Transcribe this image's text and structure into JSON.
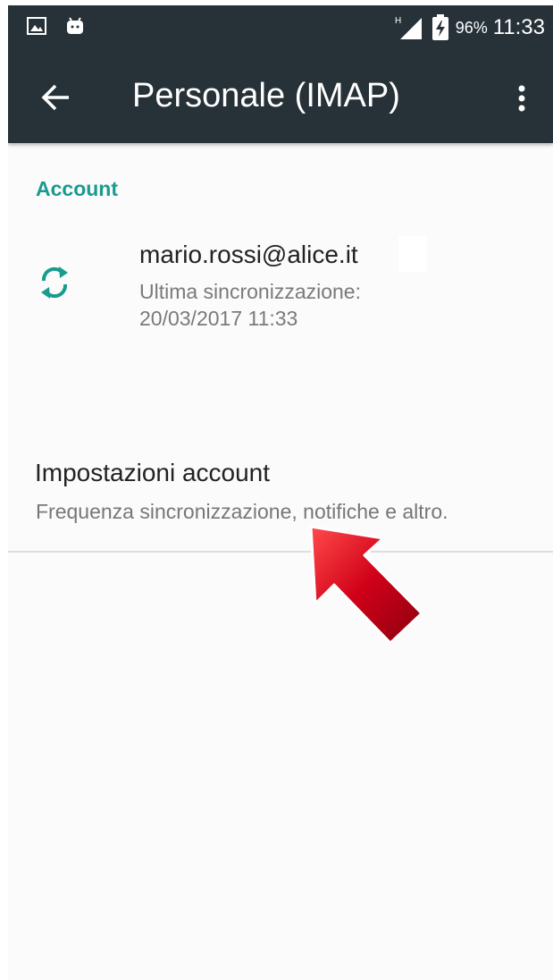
{
  "status_bar": {
    "battery_percent": "96%",
    "time": "11:33",
    "network_type": "H",
    "icons": [
      "image-icon",
      "android-icon",
      "signal-icon",
      "battery-charging-icon"
    ]
  },
  "toolbar": {
    "title": "Personale (IMAP)",
    "back_icon": "arrow-back-icon",
    "more_icon": "more-vert-icon"
  },
  "section": {
    "header": "Account"
  },
  "account": {
    "email": "mario.rossi@alice.it",
    "sync_label": "Ultima sincronizzazione:",
    "sync_time": "20/03/2017 11:33",
    "icon": "sync-icon"
  },
  "settings": {
    "title": "Impostazioni account",
    "subtitle": "Frequenza sincronizzazione, notifiche e altro."
  },
  "colors": {
    "toolbar_bg": "#263238",
    "accent": "#1a9b8f",
    "arrow_red": "#d00018"
  }
}
